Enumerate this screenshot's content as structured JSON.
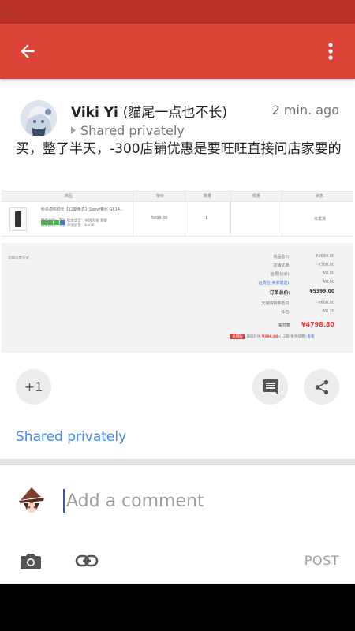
{
  "author": {
    "name": "Viki Yi",
    "alt_name": "(貓尾一点也不长)",
    "time": "2 min. ago",
    "visibility": "Shared privately"
  },
  "post": {
    "text": "买，整了半天，-300店铺优惠是要旺旺直接问店家要的"
  },
  "actions": {
    "plus_one": "+1",
    "shared_link": "Shared privately"
  },
  "composer": {
    "placeholder": "Add a comment",
    "post_label": "POST"
  },
  "icons": {
    "back": "back-arrow-icon",
    "more": "more-vert-icon",
    "comment": "comment-icon",
    "share": "share-icon",
    "camera": "camera-icon",
    "link": "link-icon"
  },
  "colors": {
    "app_bar": "#db4437",
    "status_bar": "#b93126",
    "link": "#4285f4",
    "cursor": "#3f51b5"
  }
}
